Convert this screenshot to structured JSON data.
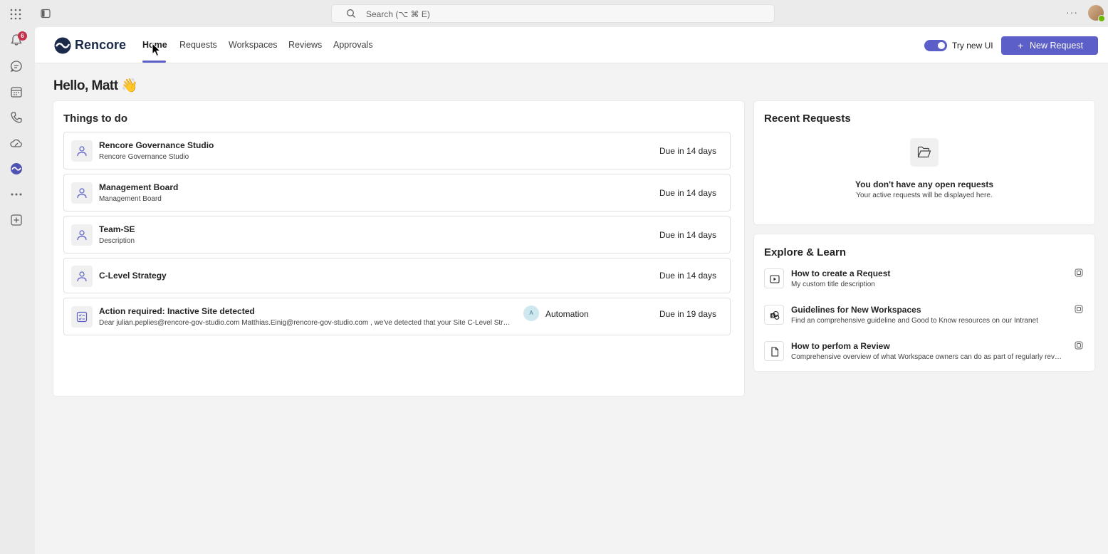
{
  "topbar": {
    "search_placeholder": "Search (⌥ ⌘ E)",
    "more": "···"
  },
  "rail": {
    "notifications_badge": "6",
    "icons": [
      "bell-icon",
      "chat-icon",
      "calendar-icon",
      "phone-icon",
      "cloud-icon",
      "rencore-app-icon",
      "more-apps-icon",
      "add-app-icon"
    ]
  },
  "header": {
    "brand": "Rencore",
    "nav": [
      "Home",
      "Requests",
      "Workspaces",
      "Reviews",
      "Approvals"
    ],
    "active_tab": "Home",
    "toggle_label": "Try new UI",
    "toggle_on": true,
    "new_request_label": "New Request",
    "accent_color": "#5b5fc7"
  },
  "greeting": "Hello, Matt 👋",
  "todo": {
    "title": "Things to do",
    "items": [
      {
        "name": "Rencore Governance Studio",
        "desc": "Rencore Governance Studio",
        "due": "Due in 14 days"
      },
      {
        "name": "Management Board",
        "desc": "Management Board",
        "due": "Due in 14 days"
      },
      {
        "name": "Team-SE",
        "desc": "Description",
        "due": "Due in 14 days"
      },
      {
        "name": "C-Level Strategy",
        "desc": "",
        "due": "Due in 14 days"
      },
      {
        "name": "Action required: Inactive Site detected",
        "desc": "Dear julian.peplies@rencore-gov-studio.com Matthias.Einig@rencore-gov-studio.com , we've detected that your Site C-Level Strategy has been inactive",
        "assignee_initial": "A",
        "assignee": "Automation",
        "due": "Due in 19 days"
      }
    ]
  },
  "recent": {
    "title": "Recent Requests",
    "empty_title": "You don't have any open requests",
    "empty_sub": "Your active requests will be displayed here."
  },
  "learn": {
    "title": "Explore & Learn",
    "items": [
      {
        "title": "How to create a Request",
        "desc": "My custom title description"
      },
      {
        "title": "Guidelines for New Workspaces",
        "desc": "Find an comprehensive guideline and Good to Know resources on our Intranet"
      },
      {
        "title": "How to perfom a Review",
        "desc": "Comprehensive overview of what Workspace owners can do as part of regularly reviewing their workspaces"
      }
    ]
  }
}
